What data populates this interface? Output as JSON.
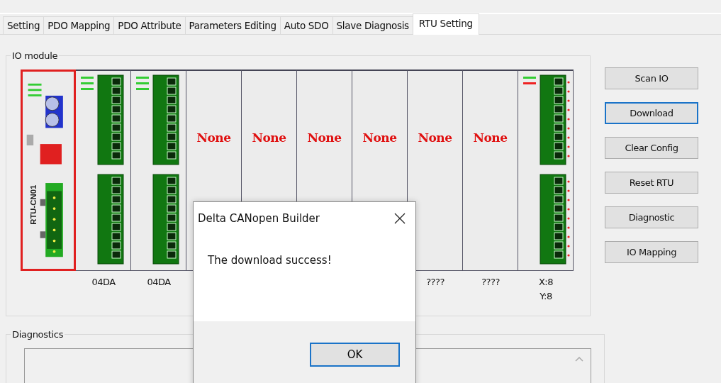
{
  "tabs": [
    {
      "label": "Setting",
      "selected": false
    },
    {
      "label": "PDO Mapping",
      "selected": false
    },
    {
      "label": "PDO Attribute",
      "selected": false
    },
    {
      "label": "Parameters Editing",
      "selected": false
    },
    {
      "label": "Auto SDO",
      "selected": false
    },
    {
      "label": "Slave Diagnosis",
      "selected": false
    },
    {
      "label": "RTU Setting",
      "selected": true
    }
  ],
  "io_module": {
    "title": "IO module",
    "slots": [
      {
        "kind": "rtu",
        "name": "RTU-CN01"
      },
      {
        "kind": "module",
        "label": "04DA"
      },
      {
        "kind": "module",
        "label": "04DA"
      },
      {
        "kind": "none",
        "text": "None"
      },
      {
        "kind": "none",
        "text": "None"
      },
      {
        "kind": "none",
        "text": "None"
      },
      {
        "kind": "none",
        "text": "None"
      },
      {
        "kind": "none",
        "text": "None",
        "label": "????"
      },
      {
        "kind": "none",
        "text": "None",
        "label": "????"
      },
      {
        "kind": "digital",
        "label_lines": [
          "X:8",
          "Y:8"
        ]
      }
    ]
  },
  "buttons": [
    {
      "label": "Scan IO",
      "focused": false
    },
    {
      "label": "Download",
      "focused": true
    },
    {
      "label": "Clear Config",
      "focused": false
    },
    {
      "label": "Reset RTU",
      "focused": false
    },
    {
      "label": "Diagnostic",
      "focused": false
    },
    {
      "label": "IO Mapping",
      "focused": false
    }
  ],
  "diagnostics": {
    "title": "Diagnostics"
  },
  "dialog": {
    "title": "Delta CANopen Builder",
    "message": "The download success!",
    "ok_button": "OK"
  }
}
